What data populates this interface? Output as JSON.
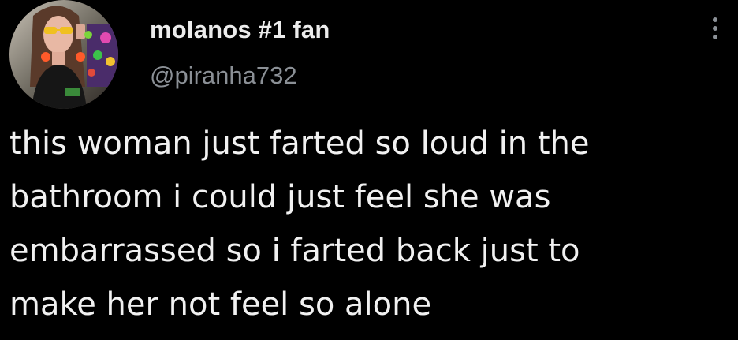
{
  "author": {
    "display_name": "molanos #1 fan",
    "handle": "@piranha732",
    "avatar_icon": "profile-photo"
  },
  "menu": {
    "icon": "more-vertical-icon"
  },
  "tweet": {
    "text": "this woman just farted so loud in the\nbathroom i could just feel she was\nembarrassed so i farted back just to\nmake her not feel so alone"
  },
  "colors": {
    "background": "#000000",
    "text_primary": "#e7e9ea",
    "text_secondary": "#8b9096"
  }
}
